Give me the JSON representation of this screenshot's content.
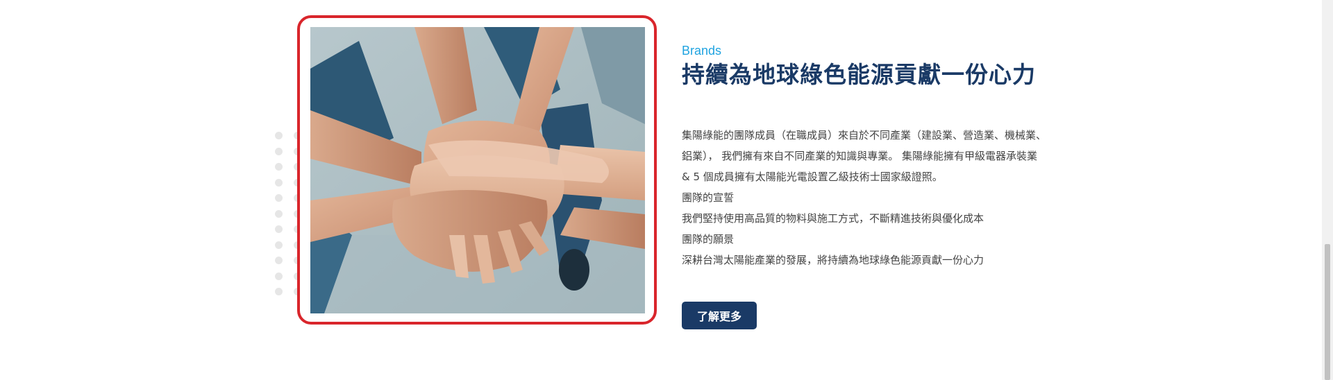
{
  "section": {
    "kicker": "Brands",
    "title": "持續為地球綠色能源貢獻一份心力",
    "intro": "集陽綠能的團隊成員（在職成員）來自於不同產業（建設業、營造業、機械業、鋁業）， 我們擁有來自不同產業的知識與專業。 集陽綠能擁有甲級電器承裝業 & 5 個成員擁有太陽能光電設置乙級技術士國家級證照。",
    "oath_heading": "團隊的宣誓",
    "oath_text": "我們堅持使用高品質的物料與施工方式，不斷精進技術與優化成本",
    "vision_heading": "團隊的願景",
    "vision_text": "深耕台灣太陽能產業的發展，將持續為地球綠色能源貢獻一份心力",
    "more_button": "了解更多"
  },
  "image": {
    "alt": "stacked-hands-teamwork-photo"
  },
  "colors": {
    "accent_red": "#d9252b",
    "kicker_blue": "#1fa3e0",
    "navy": "#1a3a66",
    "body_text": "#444444",
    "dot_gray": "#e6e6e6"
  }
}
